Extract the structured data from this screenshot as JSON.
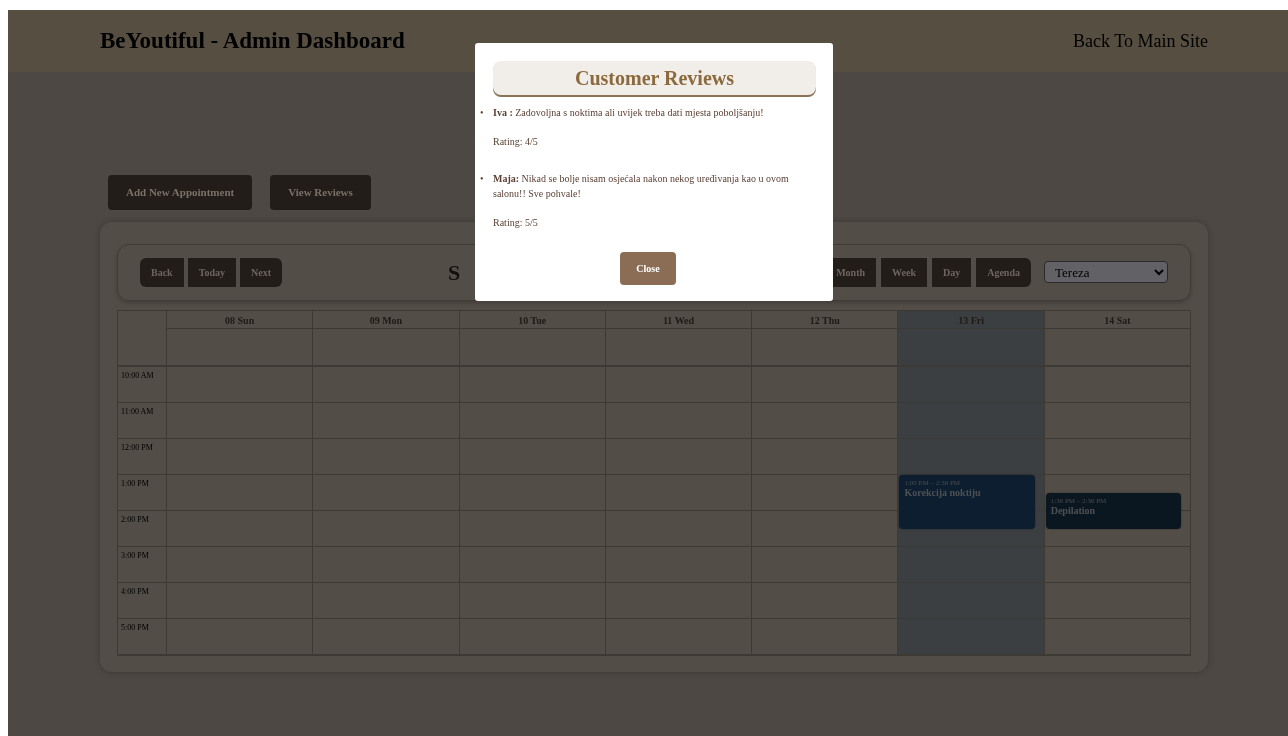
{
  "navbar": {
    "brand": "BeYoutiful - Admin Dashboard",
    "link": "Back To Main Site"
  },
  "actions": [
    "Add New Appointment",
    "View Reviews"
  ],
  "calendar": {
    "nav_buttons": [
      "Back",
      "Today",
      "Next"
    ],
    "label": "S",
    "view_buttons": [
      {
        "label": "Month",
        "selected": false
      },
      {
        "label": "Week",
        "selected": false
      },
      {
        "label": "Day",
        "selected": false
      },
      {
        "label": "Agenda",
        "selected": false
      }
    ],
    "staff_select": "Tereza",
    "days": [
      {
        "label": "08 Sun",
        "selected": false
      },
      {
        "label": "09 Mon",
        "selected": false
      },
      {
        "label": "10 Tue",
        "selected": false
      },
      {
        "label": "11 Wed",
        "selected": false
      },
      {
        "label": "12 Thu",
        "selected": false
      },
      {
        "label": "13 Fri",
        "selected": true,
        "events": [
          {
            "time": "1:00 PM – 2:30 PM",
            "title": "Korekcija noktiju",
            "color": "#0c1e30"
          }
        ]
      },
      {
        "label": "14 Sat",
        "selected": false,
        "events": [
          {
            "time": "1:30 PM – 2:30 PM",
            "title": "Depilation",
            "color": "#0b1720"
          }
        ]
      }
    ],
    "times": [
      "10:00 AM",
      "11:00 AM",
      "12:00 PM",
      "1:00 PM",
      "2:00 PM",
      "3:00 PM",
      "4:00 PM",
      "5:00 PM"
    ]
  },
  "modal": {
    "title": "Customer Reviews",
    "reviews": [
      {
        "bullet": "•",
        "name": "Iva :",
        "text": "Zadovoljna s noktima ali uvijek treba dati mjesta poboljšanju!",
        "rating": "Rating: 4/5"
      },
      {
        "bullet": "•",
        "name": "Maja:",
        "text": "Nikad se bolje nisam osjećala nakon nekog uređivanja kao u ovom salonu!! Sve pohvale!",
        "rating": "Rating: 5/5"
      }
    ],
    "close": "Close"
  }
}
